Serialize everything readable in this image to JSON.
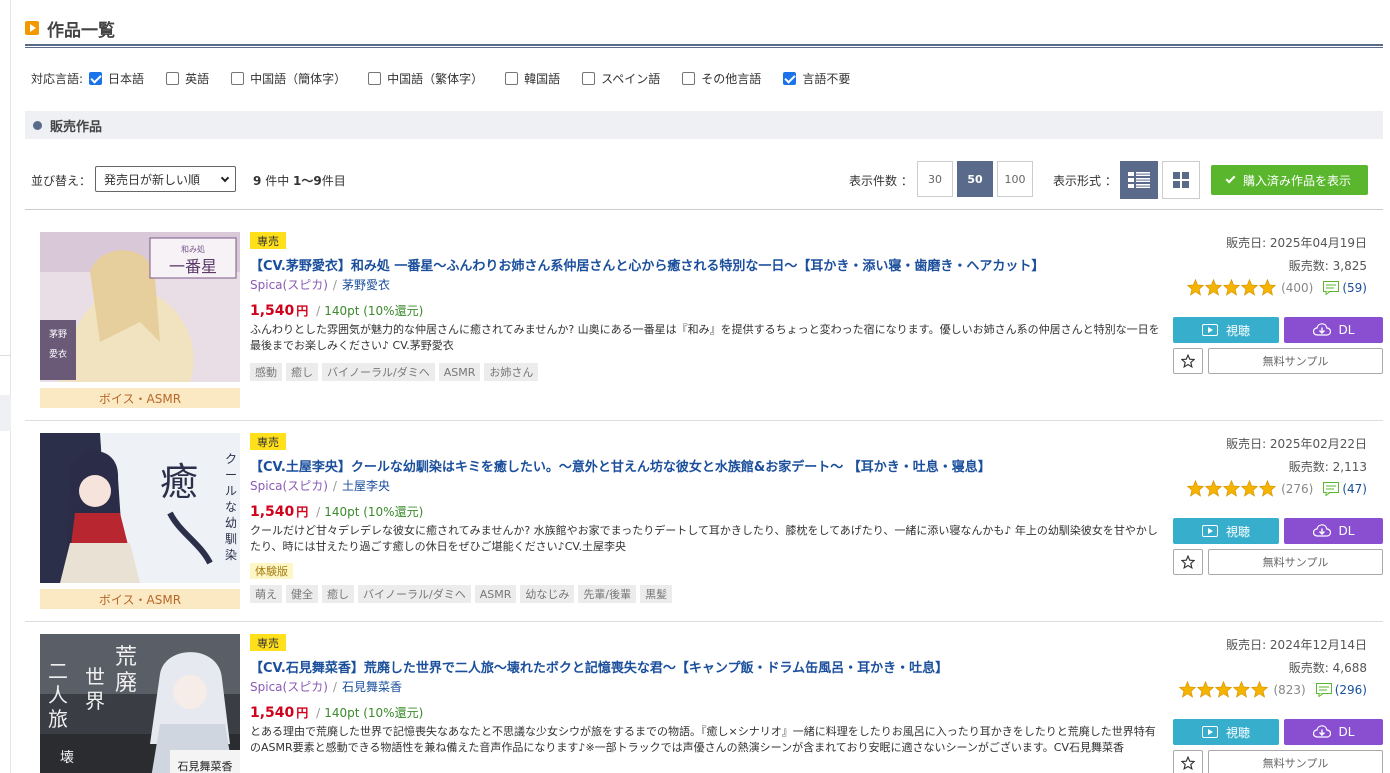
{
  "page": {
    "title": "作品一覧"
  },
  "languages": {
    "label": "対応言語:",
    "items": [
      {
        "label": "日本語",
        "checked": true
      },
      {
        "label": "英語",
        "checked": false
      },
      {
        "label": "中国語（簡体字）",
        "checked": false
      },
      {
        "label": "中国語（繁体字）",
        "checked": false
      },
      {
        "label": "韓国語",
        "checked": false
      },
      {
        "label": "スペイン語",
        "checked": false
      },
      {
        "label": "その他言語",
        "checked": false
      },
      {
        "label": "言語不要",
        "checked": true
      }
    ]
  },
  "section": {
    "title": "販売作品"
  },
  "toolbar": {
    "sort_label": "並び替え：",
    "sort_value": "発売日が新しい順",
    "total": "9",
    "count_mid": "件中",
    "range": "1〜9",
    "count_suffix": "件目",
    "per_page_label": "表示件数 ：",
    "per_page_options": [
      "30",
      "50",
      "100"
    ],
    "per_page_selected": "50",
    "view_label": "表示形式 ：",
    "purchased_label": "購入済み作品を表示"
  },
  "items": [
    {
      "badge": "専売",
      "title": "【CV.茅野愛衣】和み処 一番星〜ふんわりお姉さん系仲居さんと心から癒される特別な一日〜【耳かき・添い寝・歯磨き・ヘアカット】",
      "circle": "Spica(スピカ)",
      "sep": "/",
      "cv": "茅野愛衣",
      "price": "1,540",
      "yen": "円",
      "slash": "/",
      "points": "140pt (10%還元)",
      "description": "ふんわりとした雰囲気が魅力的な仲居さんに癒されてみませんか? 山奥にある一番星は『和み』を提供するちょっと変わった宿になります。優しいお姉さん系の仲居さんと特別な一日を最後までお楽しみください♪ CV.茅野愛衣",
      "trial": "",
      "tags": [
        "感動",
        "癒し",
        "バイノーラル/ダミヘ",
        "ASMR",
        "お姉さん"
      ],
      "category": "ボイス・ASMR",
      "release": "販売日: 2025年04月19日",
      "sales": "販売数: 3,825",
      "rating": 5,
      "rating_count": "(400)",
      "comment_count": "(59)",
      "listen_label": "視聴",
      "dl_label": "DL",
      "sample_label": "無料サンプル",
      "thumb_text": "和み処 一番星",
      "thumb_sub": "茅野愛衣"
    },
    {
      "badge": "専売",
      "title": "【CV.土屋李央】クールな幼馴染はキミを癒したい。〜意外と甘えん坊な彼女と水族館&お家デート〜 【耳かき・吐息・寝息】",
      "circle": "Spica(スピカ)",
      "sep": "/",
      "cv": "土屋李央",
      "price": "1,540",
      "yen": "円",
      "slash": "/",
      "points": "140pt (10%還元)",
      "description": "クールだけど甘々デレデレな彼女に癒されてみませんか? 水族館やお家でまったりデートして耳かきしたり、膝枕をしてあげたり、一緒に添い寝なんかも♪ 年上の幼馴染彼女を甘やかしたり、時には甘えたり過ごす癒しの休日をぜひご堪能ください♪CV.土屋李央",
      "trial": "体験版",
      "tags": [
        "萌え",
        "健全",
        "癒し",
        "バイノーラル/ダミヘ",
        "ASMR",
        "幼なじみ",
        "先輩/後輩",
        "黒髪"
      ],
      "category": "ボイス・ASMR",
      "release": "販売日: 2025年02月22日",
      "sales": "販売数: 2,113",
      "rating": 5,
      "rating_count": "(276)",
      "comment_count": "(47)",
      "listen_label": "視聴",
      "dl_label": "DL",
      "sample_label": "無料サンプル",
      "thumb_text": "癒したい",
      "thumb_sub": "クールな幼馴染はキミを"
    },
    {
      "badge": "専売",
      "title": "【CV.石見舞菜香】荒廃した世界で二人旅〜壊れたボクと記憶喪失な君〜【キャンプ飯・ドラム缶風呂・耳かき・吐息】",
      "circle": "Spica(スピカ)",
      "sep": "/",
      "cv": "石見舞菜香",
      "price": "1,540",
      "yen": "円",
      "slash": "/",
      "points": "140pt (10%還元)",
      "description": "とある理由で荒廃した世界で記憶喪失なあなたと不思議な少女シウが旅をするまでの物語。『癒し×シナリオ』一緒に料理をしたりお風呂に入ったり耳かきをしたりと荒廃した世界特有のASMR要素と感動できる物語性を兼ね備えた音声作品になります♪※一部トラックでは声優さんの熱演シーンが含まれており安眠に適さないシーンがございます。CV石見舞菜香",
      "trial": "",
      "tags": [],
      "category": "",
      "release": "販売日: 2024年12月14日",
      "sales": "販売数: 4,688",
      "rating": 5,
      "rating_count": "(823)",
      "comment_count": "(296)",
      "listen_label": "視聴",
      "dl_label": "DL",
      "sample_label": "無料サンプル",
      "thumb_text": "荒廃した世界で二人旅",
      "thumb_sub": "石見舞菜香"
    }
  ],
  "colors": {
    "accent": "#5a6a8a",
    "price": "#d0021b",
    "points": "#3a8a2a",
    "title_link": "#1b4f9c",
    "badge": "#ffe01a",
    "listen": "#37afcc",
    "download": "#8a4fd0",
    "purchased": "#5ab72d"
  }
}
